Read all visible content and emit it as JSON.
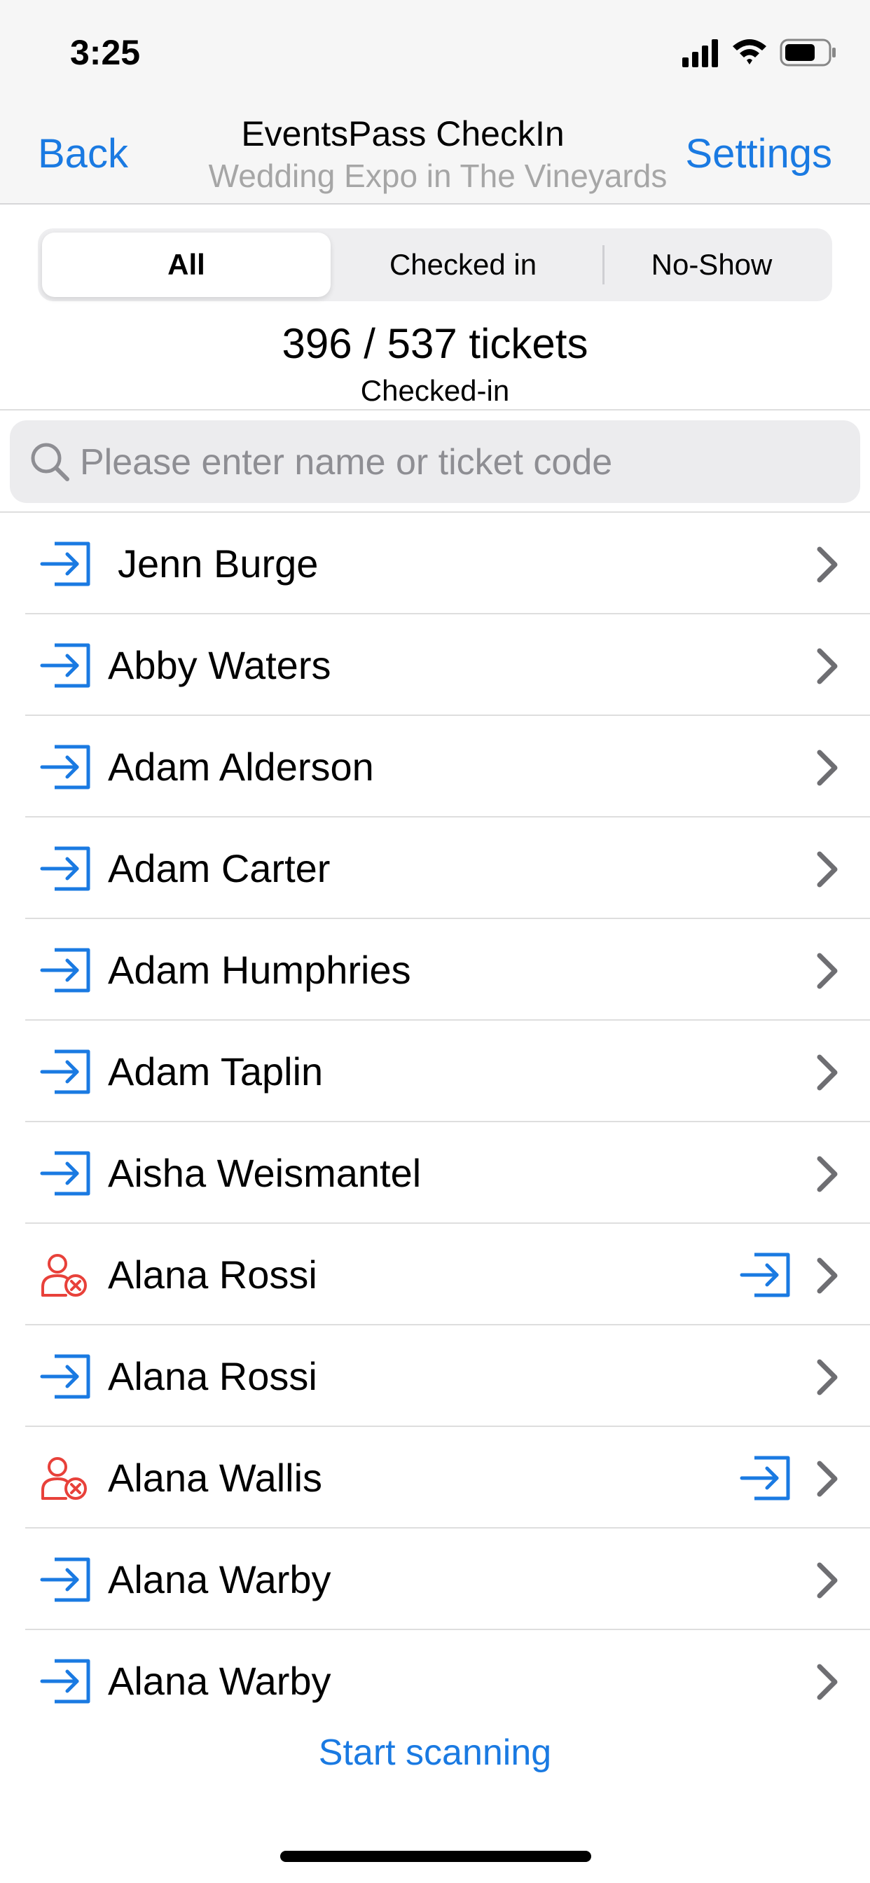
{
  "status_bar": {
    "time": "3:25"
  },
  "nav": {
    "back_label": "Back",
    "title": "EventsPass CheckIn",
    "subtitle": "Wedding Expo in The Vineyards",
    "settings_label": "Settings"
  },
  "tabs": {
    "selected": "All",
    "items": [
      {
        "label": "All"
      },
      {
        "label": "Checked in"
      },
      {
        "label": "No-Show"
      }
    ]
  },
  "summary": {
    "count_text": "396 / 537 tickets",
    "status_text": "Checked-in"
  },
  "search": {
    "placeholder": "Please enter name or ticket code",
    "value": ""
  },
  "attendees": [
    {
      "name": "Jenn Burge",
      "status_icon": "check-in-icon",
      "show_checkin_button": false
    },
    {
      "name": "Abby Waters",
      "status_icon": "check-in-icon",
      "show_checkin_button": false
    },
    {
      "name": "Adam Alderson",
      "status_icon": "check-in-icon",
      "show_checkin_button": false
    },
    {
      "name": "Adam Carter",
      "status_icon": "check-in-icon",
      "show_checkin_button": false
    },
    {
      "name": "Adam Humphries",
      "status_icon": "check-in-icon",
      "show_checkin_button": false
    },
    {
      "name": "Adam Taplin",
      "status_icon": "check-in-icon",
      "show_checkin_button": false
    },
    {
      "name": "Aisha Weismantel",
      "status_icon": "check-in-icon",
      "show_checkin_button": false
    },
    {
      "name": "Alana Rossi",
      "status_icon": "no-show-person-icon",
      "show_checkin_button": true
    },
    {
      "name": "Alana Rossi",
      "status_icon": "check-in-icon",
      "show_checkin_button": false
    },
    {
      "name": "Alana Wallis",
      "status_icon": "no-show-person-icon",
      "show_checkin_button": true
    },
    {
      "name": "Alana Warby",
      "status_icon": "check-in-icon",
      "show_checkin_button": false
    },
    {
      "name": "Alana Warby",
      "status_icon": "check-in-icon",
      "show_checkin_button": false
    }
  ],
  "footer": {
    "scan_label": "Start scanning"
  },
  "colors": {
    "accent": "#1a7ae2",
    "no_show": "#e8413a",
    "separator": "#dedede"
  }
}
